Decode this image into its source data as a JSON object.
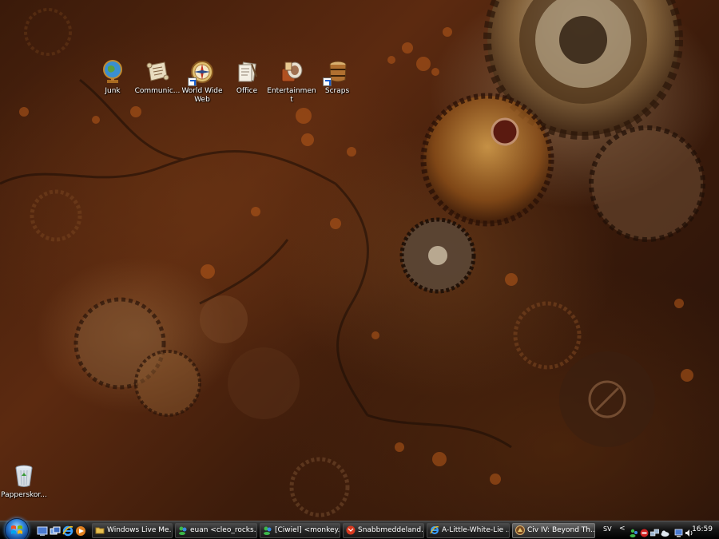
{
  "desktop": {
    "icons": [
      {
        "label": "Junk",
        "icon": "globe-icon"
      },
      {
        "label": "Communic...",
        "icon": "scroll-icon"
      },
      {
        "label": "World Wide Web",
        "icon": "compass-icon"
      },
      {
        "label": "Office",
        "icon": "papers-icon"
      },
      {
        "label": "Entertainment",
        "icon": "media-icon"
      },
      {
        "label": "Scraps",
        "icon": "barrel-icon"
      }
    ],
    "recycle_bin": {
      "label": "Papperskor...",
      "icon": "recycle-bin-icon"
    }
  },
  "taskbar": {
    "quick_launch": [
      "show-desktop-icon",
      "switch-windows-icon",
      "internet-explorer-icon",
      "media-player-icon"
    ],
    "buttons": [
      {
        "label": "Windows Live Me...",
        "icon": "folder-icon"
      },
      {
        "label": "euan <cleo_rocks...",
        "icon": "messenger-icon"
      },
      {
        "label": "[Ciwiel] <monkey...",
        "icon": "messenger-icon"
      },
      {
        "label": "Snabbmeddeland...",
        "icon": "gmail-icon"
      },
      {
        "label": "A-Little-White-Lie ...",
        "icon": "ie-icon"
      },
      {
        "label": "Civ IV: Beyond Th...",
        "icon": "civ-icon"
      }
    ],
    "tray": {
      "language": "SV",
      "time": "16:59"
    }
  },
  "colors": {
    "taskbar": "#141414",
    "label_text": "#ffffff",
    "start_orb": "#2d7fd6"
  }
}
